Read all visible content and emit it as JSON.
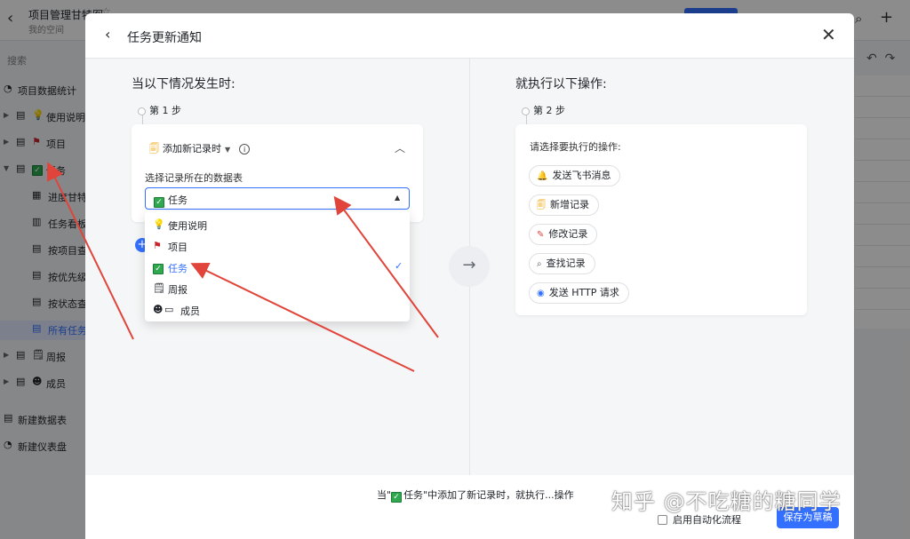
{
  "background": {
    "doc_title": "项目管理甘特图",
    "doc_subtitle": "我的空间",
    "search_placeholder": "搜索",
    "sidebar": [
      {
        "label": "项目数据统计",
        "icon": "dashboard-icon"
      },
      {
        "label": "使用说明",
        "icon": "bulb-icon"
      },
      {
        "label": "项目",
        "icon": "flag-icon"
      },
      {
        "label": "任务",
        "icon": "check-icon"
      },
      {
        "label": "进度甘特",
        "icon": "gantt-icon"
      },
      {
        "label": "任务看板",
        "icon": "kanban-icon"
      },
      {
        "label": "按项目查",
        "icon": "table-icon"
      },
      {
        "label": "按优先级",
        "icon": "table-icon"
      },
      {
        "label": "按状态查",
        "icon": "table-icon"
      },
      {
        "label": "所有任务",
        "icon": "table-icon"
      },
      {
        "label": "周报",
        "icon": "report-icon"
      },
      {
        "label": "成员",
        "icon": "person-icon"
      },
      {
        "label": "新建数据表",
        "icon": "table-icon"
      },
      {
        "label": "新建仪表盘",
        "icon": "dashboard-icon"
      }
    ]
  },
  "modal": {
    "title": "任务更新通知",
    "left_title": "当以下情况发生时:",
    "step1": "第 1 步",
    "trigger_label": "添加新记录时",
    "field_label": "选择记录所在的数据表",
    "selected_table": "任务",
    "dropdown": [
      {
        "label": "使用说明",
        "icon": "bulb-icon"
      },
      {
        "label": "项目",
        "icon": "flag-icon"
      },
      {
        "label": "任务",
        "icon": "check-icon",
        "selected": true
      },
      {
        "label": "周报",
        "icon": "report-icon"
      },
      {
        "label": "成员",
        "icon": "person-icon"
      }
    ],
    "right_title": "就执行以下操作:",
    "step2": "第 2 步",
    "action_prompt": "请选择要执行的操作:",
    "actions": [
      {
        "label": "发送飞书消息",
        "icon": "bell-icon"
      },
      {
        "label": "新增记录",
        "icon": "add-record-icon"
      },
      {
        "label": "修改记录",
        "icon": "edit-icon"
      },
      {
        "label": "查找记录",
        "icon": "search-icon"
      },
      {
        "label": "发送 HTTP 请求",
        "icon": "globe-icon"
      }
    ],
    "footer_prefix": "当\"",
    "footer_table": "任务",
    "footer_suffix": "\"中添加了新记录时，就执行...操作",
    "enable_label": "启用自动化流程",
    "save_label": "保存为草稿"
  },
  "watermark": "知乎 @不吃糖的糖同学",
  "colors": {
    "accent": "#3370ff",
    "annotation": "#e0443a",
    "check": "#2fa84f"
  }
}
